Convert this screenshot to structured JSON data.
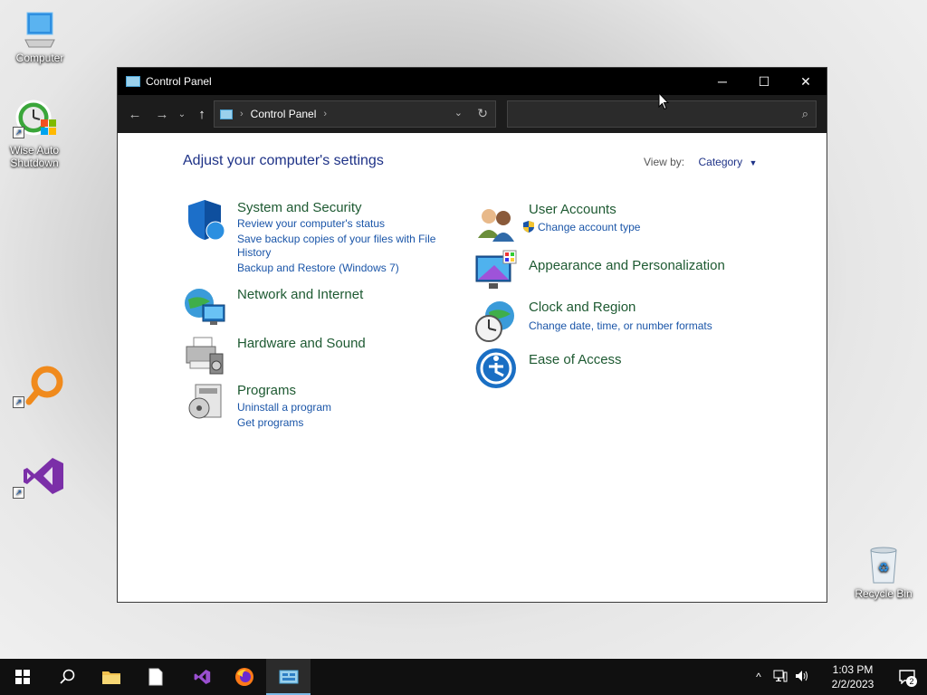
{
  "desktop": {
    "icons": [
      {
        "name": "computer",
        "label": "Computer"
      },
      {
        "name": "wise-auto-shutdown",
        "label": "Wise Auto Shutdown"
      },
      {
        "name": "search-app",
        "label": ""
      },
      {
        "name": "visual-studio",
        "label": ""
      },
      {
        "name": "recycle-bin",
        "label": "Recycle Bin"
      }
    ]
  },
  "window": {
    "title": "Control Panel",
    "minimize": "─",
    "maximize": "☐",
    "close": "✕",
    "nav": {
      "back": "←",
      "forward": "→",
      "recent": "⌄",
      "up": "↑"
    },
    "address": {
      "crumb": "Control Panel",
      "sep": "›",
      "trail_sep": "›",
      "dropdown": "⌄",
      "refresh": "↻"
    },
    "search": {
      "placeholder": "",
      "icon": "⌕"
    }
  },
  "content": {
    "heading": "Adjust your computer's settings",
    "view_by_label": "View by:",
    "view_by_value": "Category",
    "categories": [
      {
        "title": "System and Security",
        "icon": "shield-icon",
        "links": [
          "Review your computer's status",
          "Save backup copies of your files with File",
          "History",
          "Backup and Restore (Windows 7)"
        ]
      },
      {
        "title": "Network and Internet",
        "icon": "globe-network-icon",
        "links": []
      },
      {
        "title": "Hardware and Sound",
        "icon": "printer-icon",
        "links": []
      },
      {
        "title": "Programs",
        "icon": "programs-icon",
        "links": [
          "Uninstall a program",
          "Get programs"
        ]
      },
      {
        "title": "User Accounts",
        "icon": "users-icon",
        "links": [
          "Change account type"
        ]
      },
      {
        "title": "Appearance and Personalization",
        "icon": "monitor-icon",
        "links": []
      },
      {
        "title": "Clock and Region",
        "icon": "clock-globe-icon",
        "links": [
          "Change date, time, or number formats"
        ]
      },
      {
        "title": "Ease of Access",
        "icon": "ease-of-access-icon",
        "links": []
      }
    ]
  },
  "taskbar": {
    "start": "⊞",
    "search": "⌕",
    "tray": {
      "chevron": "^",
      "time": "1:03 PM",
      "date": "2/2/2023",
      "notifications": "2"
    }
  },
  "colors": {
    "link": "#1a55a8",
    "category_title": "#1e5a32",
    "heading": "#1e3287",
    "taskbar": "#101010"
  }
}
